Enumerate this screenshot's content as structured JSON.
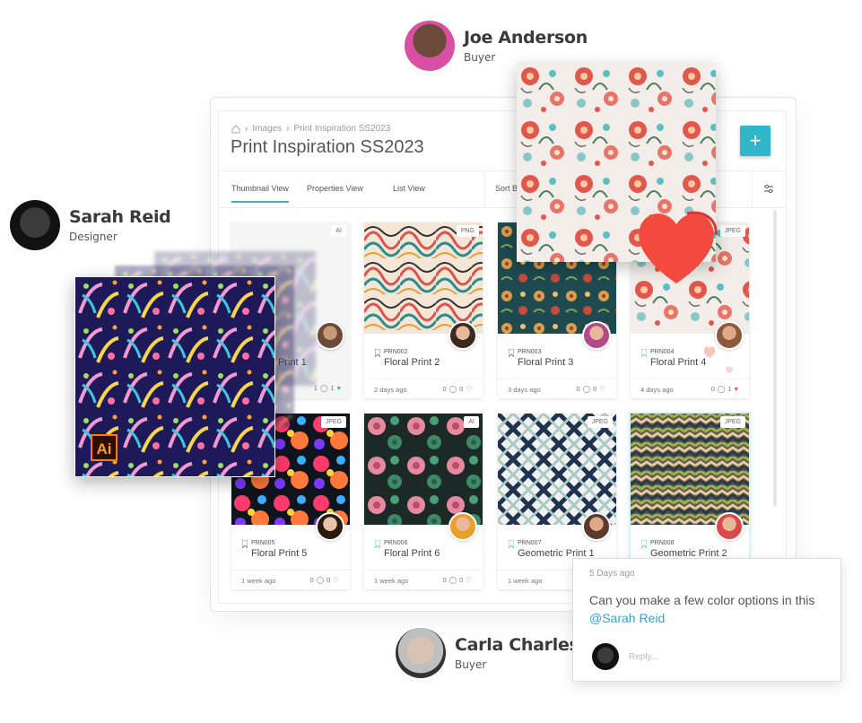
{
  "personas": {
    "top": {
      "name": "Joe Anderson",
      "role": "Buyer"
    },
    "left": {
      "name": "Sarah Reid",
      "role": "Designer"
    },
    "bottom": {
      "name": "Carla Charles",
      "role": "Buyer"
    }
  },
  "app": {
    "breadcrumb": [
      "Images",
      "Print Inspiration SS2023"
    ],
    "title": "Print Inspiration SS2023",
    "add_label": "+",
    "tabs": [
      "Thumbnail View",
      "Properties View",
      "List View"
    ],
    "sort_label": "Sort By"
  },
  "cards": [
    {
      "format": "AI",
      "code": "",
      "name": "Print 1",
      "age": "",
      "comments": "1",
      "likes": "1"
    },
    {
      "format": "PNG",
      "code": "PRN002",
      "name": "Floral Print 2",
      "age": "2 days ago",
      "comments": "0",
      "likes": "0"
    },
    {
      "format": "",
      "code": "PRN003",
      "name": "Floral Print 3",
      "age": "3 days ago",
      "comments": "0",
      "likes": "0"
    },
    {
      "format": "JPEG",
      "code": "PRN004",
      "name": "Floral Print 4",
      "age": "4 days ago",
      "comments": "0",
      "likes": "1"
    },
    {
      "format": "JPEG",
      "code": "PRN005",
      "name": "Floral Print 5",
      "age": "1 week ago",
      "comments": "0",
      "likes": "0"
    },
    {
      "format": "AI",
      "code": "PRN006",
      "name": "Floral Print 6",
      "age": "1 week ago",
      "comments": "0",
      "likes": "0"
    },
    {
      "format": "JPEG",
      "code": "PRN007",
      "name": "Geometric Print 1",
      "age": "1 week ago",
      "comments": "0",
      "likes": "0"
    },
    {
      "format": "JPEG",
      "code": "PRN008",
      "name": "Geometric Print 2",
      "age": "",
      "comments": "",
      "likes": ""
    }
  ],
  "ai_badge": "Ai",
  "comment": {
    "timestamp": "5 Days ago",
    "text": "Can you make a few color options in this",
    "mention": "@Sarah Reid",
    "reply_placeholder": "Reply..."
  },
  "colors": {
    "accent": "#2fb6c8",
    "like": "#f04c4c",
    "mention": "#2fa5d0"
  }
}
